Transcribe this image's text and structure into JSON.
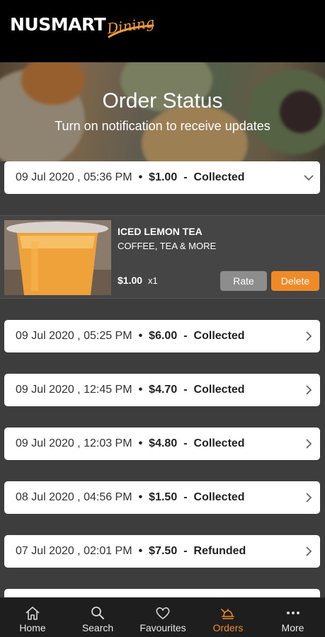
{
  "header": {
    "logo_main": "NUSMART",
    "logo_script": "Dining"
  },
  "hero": {
    "title": "Order Status",
    "subtitle": "Turn on notification to receive updates"
  },
  "orders": [
    {
      "date": "09 Jul 2020 , 05:36 PM",
      "amount": "$1.00",
      "status": "Collected",
      "expanded": true
    },
    {
      "date": "09 Jul 2020 , 05:25 PM",
      "amount": "$6.00",
      "status": "Collected",
      "expanded": false
    },
    {
      "date": "09 Jul 2020 , 12:45 PM",
      "amount": "$4.70",
      "status": "Collected",
      "expanded": false
    },
    {
      "date": "09 Jul 2020 , 12:03 PM",
      "amount": "$4.80",
      "status": "Collected",
      "expanded": false
    },
    {
      "date": "08 Jul 2020 , 04:56 PM",
      "amount": "$1.50",
      "status": "Collected",
      "expanded": false
    },
    {
      "date": "07 Jul 2020 , 02:01 PM",
      "amount": "$7.50",
      "status": "Refunded",
      "expanded": false
    }
  ],
  "separator": "•",
  "dash": "-",
  "order_item": {
    "name": "ICED LEMON TEA",
    "category": "COFFEE, TEA & MORE",
    "price": "$1.00",
    "quantity": "x1",
    "rate_label": "Rate",
    "delete_label": "Delete"
  },
  "nav": [
    {
      "label": "Home",
      "icon": "home-icon",
      "active": false
    },
    {
      "label": "Search",
      "icon": "search-icon",
      "active": false
    },
    {
      "label": "Favourites",
      "icon": "heart-icon",
      "active": false
    },
    {
      "label": "Orders",
      "icon": "orders-icon",
      "active": true
    },
    {
      "label": "More",
      "icon": "more-icon",
      "active": false
    }
  ],
  "colors": {
    "accent": "#f08a26",
    "header_bg": "#000000",
    "list_bg": "#3d3d3d",
    "nav_bg": "#1e1e1e",
    "rate_button": "#8d8d8d"
  }
}
